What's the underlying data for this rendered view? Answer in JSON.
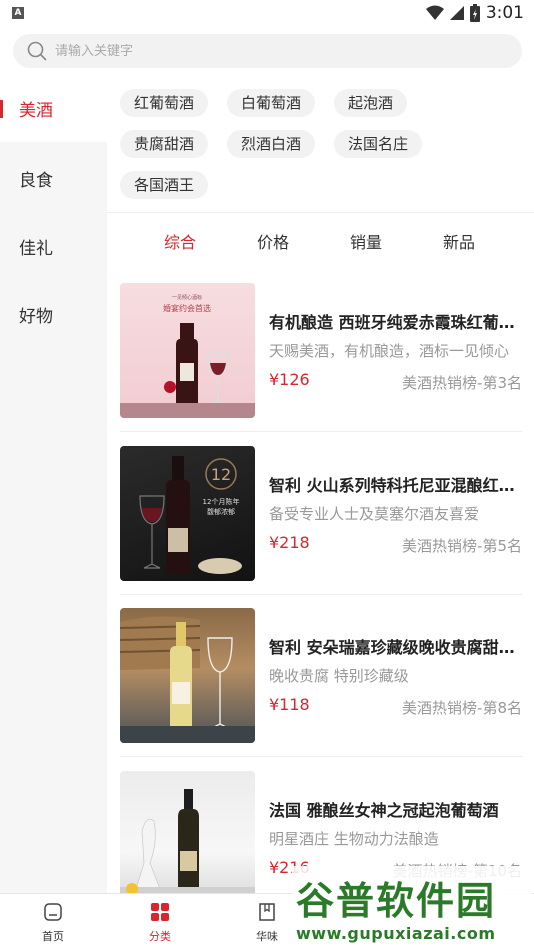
{
  "status": {
    "time": "3:01"
  },
  "search": {
    "placeholder": "请输入关键字"
  },
  "sidebar": {
    "items": [
      {
        "label": "美酒",
        "active": true
      },
      {
        "label": "良食"
      },
      {
        "label": "佳礼"
      },
      {
        "label": "好物"
      }
    ]
  },
  "tags": [
    "红葡萄酒",
    "白葡萄酒",
    "起泡酒",
    "贵腐甜酒",
    "烈酒白酒",
    "法国名庄",
    "各国酒王"
  ],
  "sort_tabs": [
    {
      "label": "综合",
      "active": true
    },
    {
      "label": "价格"
    },
    {
      "label": "销量"
    },
    {
      "label": "新品"
    }
  ],
  "products": [
    {
      "title": "有机酿造 西班牙纯爱赤霞珠红葡萄酒",
      "desc": "天赐美酒，有机酿造，酒标一见倾心",
      "price": "¥126",
      "rank": "美酒热销榜-第3名",
      "thumb_text_1": "一见倾心酒标",
      "thumb_text_2": "婚宴约会首选"
    },
    {
      "title": "智利 火山系列特科托尼亚混酿红葡萄酒",
      "desc": "备受专业人士及莫塞尔酒友喜爱",
      "price": "¥218",
      "rank": "美酒热销榜-第5名",
      "thumb_text_1": "12",
      "thumb_text_2": "12个月陈年",
      "thumb_text_3": "馥郁浓郁"
    },
    {
      "title": "智利 安朵瑞嘉珍藏级晚收贵腐甜白葡萄酒",
      "desc": "晚收贵腐 特别珍藏级",
      "price": "¥118",
      "rank": "美酒热销榜-第8名"
    },
    {
      "title": "法国 雅酿丝女神之冠起泡葡萄酒",
      "desc": "明星酒庄 生物动力法酿造",
      "price": "¥216",
      "rank": "美酒热销榜-第10名"
    }
  ],
  "bottom_nav": [
    {
      "label": "首页",
      "icon": "home-icon"
    },
    {
      "label": "分类",
      "icon": "grid-icon",
      "active": true
    },
    {
      "label": "华味",
      "icon": "book-icon"
    }
  ],
  "watermark": {
    "title": "谷普软件园",
    "url": "www.gupuxiazai.com"
  },
  "colors": {
    "accent": "#d7262e"
  }
}
